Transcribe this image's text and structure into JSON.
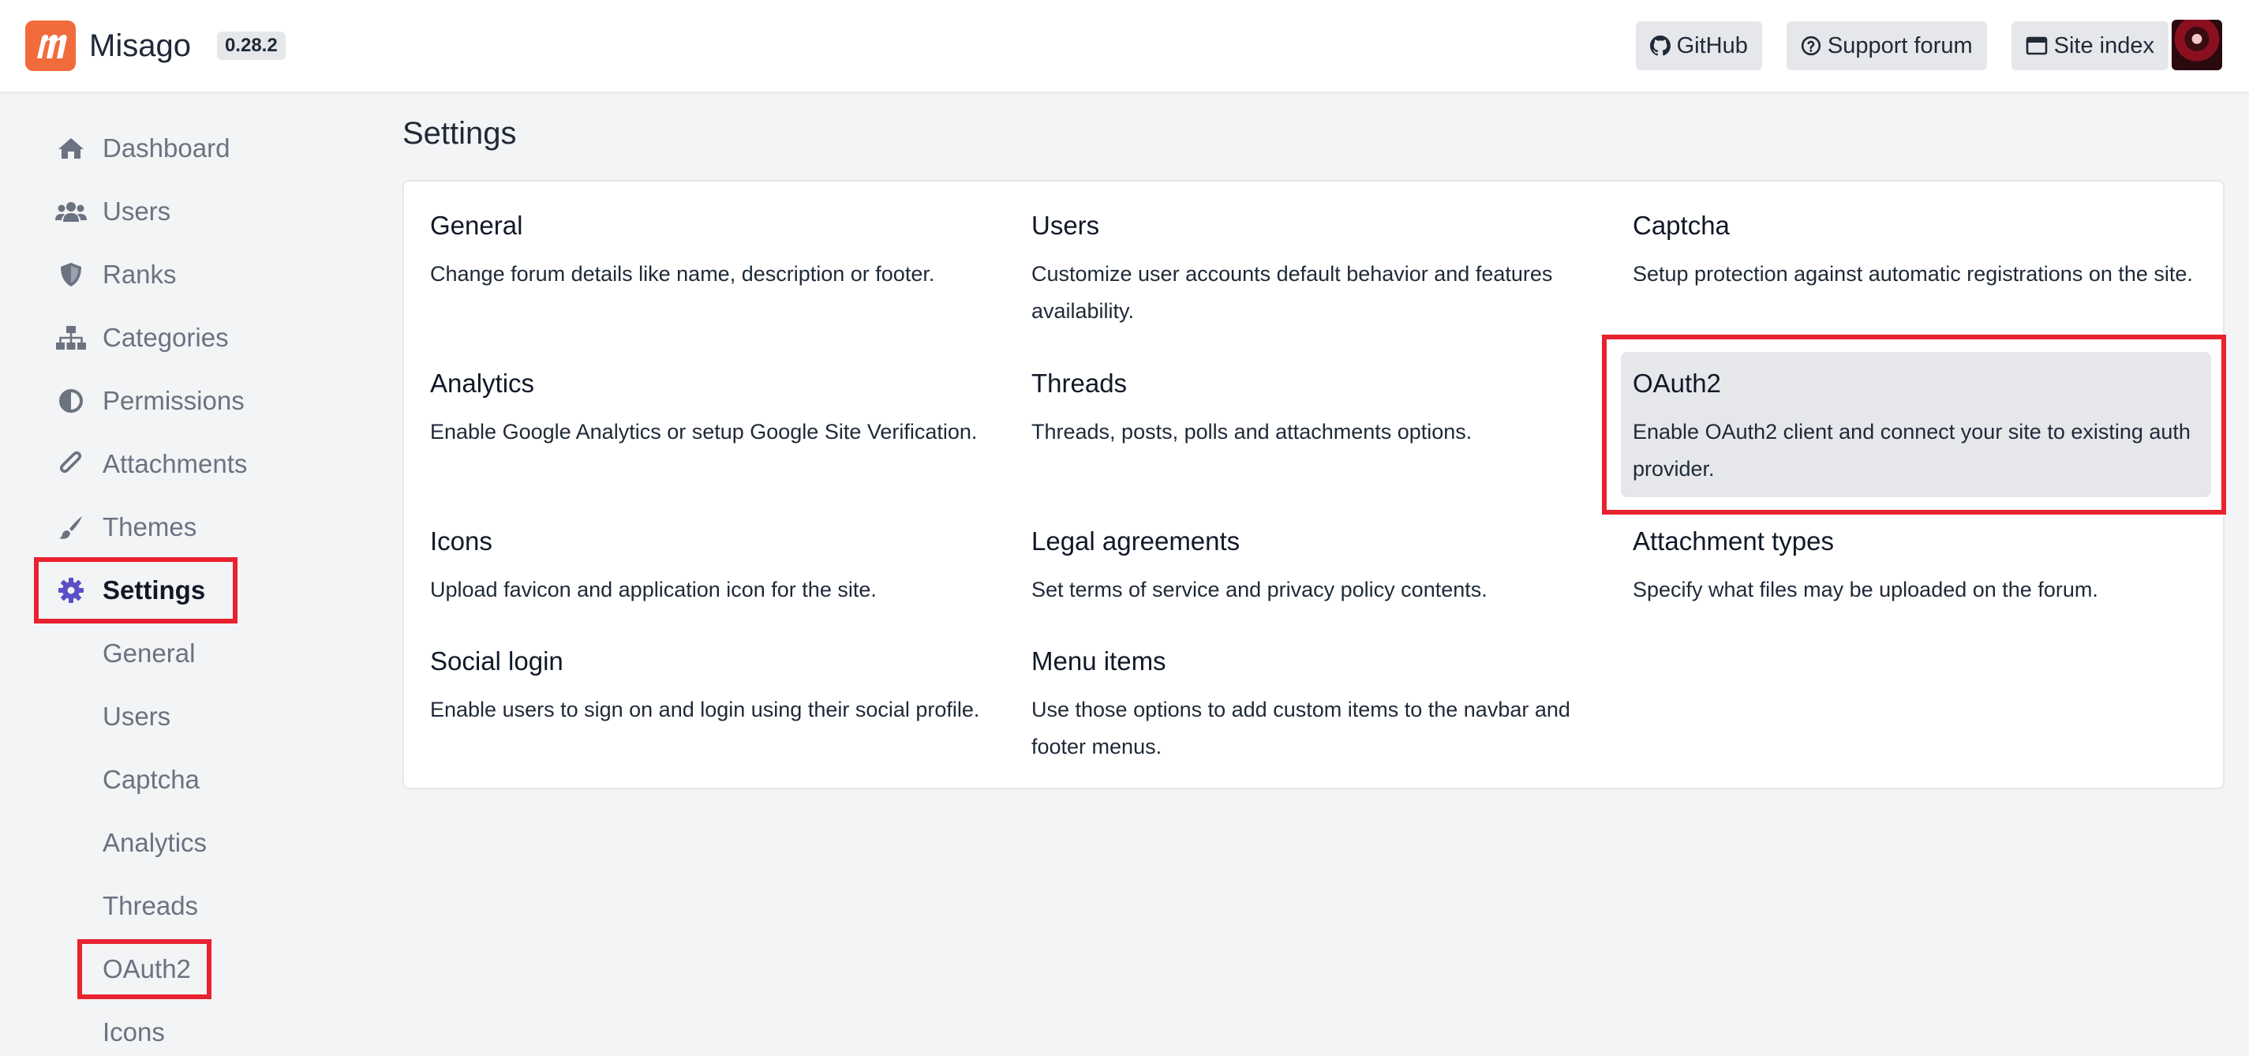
{
  "brand": {
    "name": "Misago",
    "version": "0.28.2"
  },
  "navbar": {
    "github_label": "GitHub",
    "support_label": "Support forum",
    "site_index_label": "Site index"
  },
  "sidebar": {
    "items": [
      {
        "label": "Dashboard",
        "icon": "home-icon"
      },
      {
        "label": "Users",
        "icon": "users-icon"
      },
      {
        "label": "Ranks",
        "icon": "shield-icon"
      },
      {
        "label": "Categories",
        "icon": "sitemap-icon"
      },
      {
        "label": "Permissions",
        "icon": "adjust-icon"
      },
      {
        "label": "Attachments",
        "icon": "paperclip-icon"
      },
      {
        "label": "Themes",
        "icon": "paint-brush-icon"
      },
      {
        "label": "Settings",
        "icon": "gear-icon",
        "active": true
      }
    ],
    "subitems": [
      "General",
      "Users",
      "Captcha",
      "Analytics",
      "Threads",
      "OAuth2",
      "Icons"
    ]
  },
  "main": {
    "title": "Settings",
    "settings": [
      {
        "title": "General",
        "description": "Change forum details like name, description or footer."
      },
      {
        "title": "Users",
        "description": "Customize user accounts default behavior and features availability."
      },
      {
        "title": "Captcha",
        "description": "Setup protection against automatic registrations on the site."
      },
      {
        "title": "Analytics",
        "description": "Enable Google Analytics or setup Google Site Verification."
      },
      {
        "title": "Threads",
        "description": "Threads, posts, polls and attachments options."
      },
      {
        "title": "OAuth2",
        "description": "Enable OAuth2 client and connect your site to existing auth provider."
      },
      {
        "title": "Icons",
        "description": "Upload favicon and application icon for the site."
      },
      {
        "title": "Legal agreements",
        "description": "Set terms of service and privacy policy contents."
      },
      {
        "title": "Attachment types",
        "description": "Specify what files may be uploaded on the forum."
      },
      {
        "title": "Social login",
        "description": "Enable users to sign on and login using their social profile."
      },
      {
        "title": "Menu items",
        "description": "Use those options to add custom items to the navbar and footer menus."
      }
    ]
  },
  "colors": {
    "brand": "#f26b3a",
    "highlight": "#e8222e",
    "active_icon": "#5b4fc7"
  }
}
